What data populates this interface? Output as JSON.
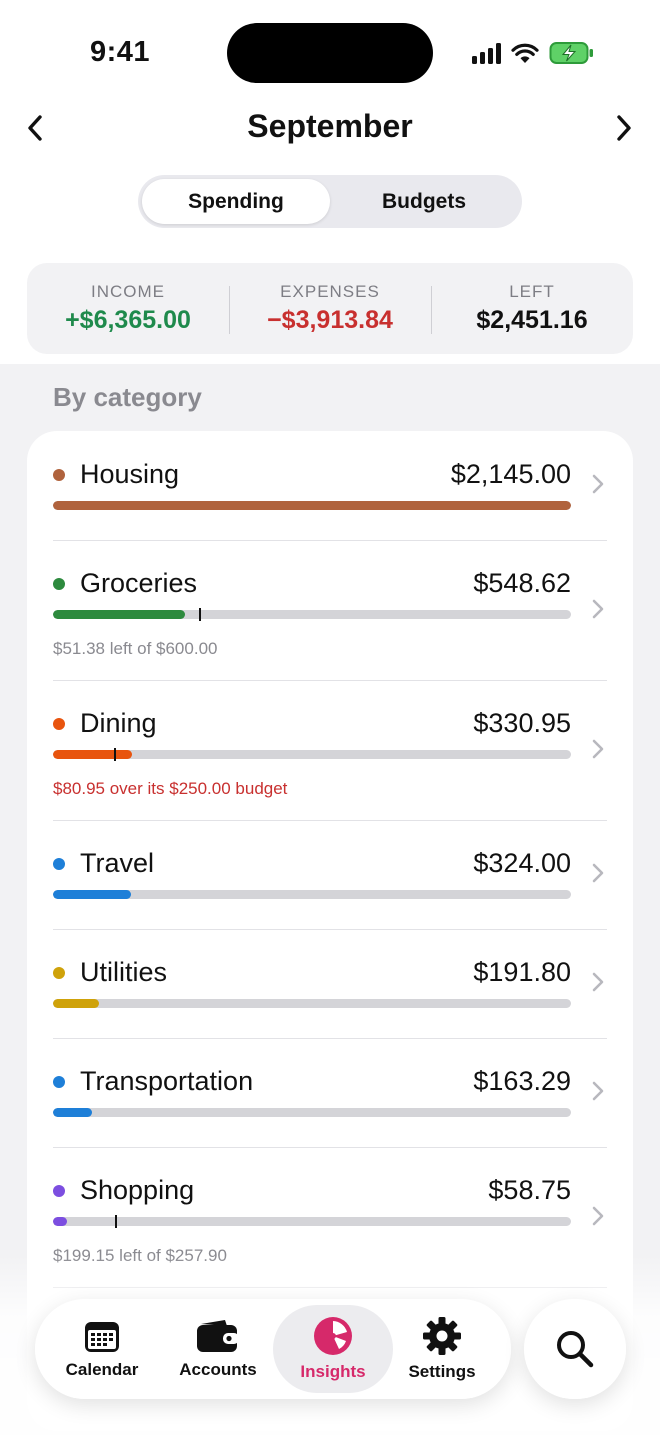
{
  "status_bar": {
    "time": "9:41"
  },
  "header": {
    "title": "September"
  },
  "segmented": {
    "spending": "Spending",
    "budgets": "Budgets",
    "selected": "Spending"
  },
  "summary": {
    "income_label": "INCOME",
    "income_value": "+$6,365.00",
    "expenses_label": "EXPENSES",
    "expenses_value": "−$3,913.84",
    "left_label": "LEFT",
    "left_value": "$2,451.16"
  },
  "section": {
    "title": "By category"
  },
  "categories": [
    {
      "name": "Housing",
      "amount": "$2,145.00",
      "color": "#b0633d",
      "fill": 1.0,
      "marker": null,
      "note": ""
    },
    {
      "name": "Groceries",
      "amount": "$548.62",
      "color": "#2d8a3e",
      "fill": 0.255,
      "marker": 0.282,
      "note": "$51.38 left of $600.00"
    },
    {
      "name": "Dining",
      "amount": "$330.95",
      "color": "#e8540e",
      "fill": 0.153,
      "marker": 0.118,
      "note": "$80.95 over its $250.00 budget",
      "note_over": true
    },
    {
      "name": "Travel",
      "amount": "$324.00",
      "color": "#1e7fd8",
      "fill": 0.151,
      "marker": null,
      "note": ""
    },
    {
      "name": "Utilities",
      "amount": "$191.80",
      "color": "#cfa20a",
      "fill": 0.089,
      "marker": null,
      "note": ""
    },
    {
      "name": "Transportation",
      "amount": "$163.29",
      "color": "#1e7fd8",
      "fill": 0.076,
      "marker": null,
      "note": ""
    },
    {
      "name": "Shopping",
      "amount": "$58.75",
      "color": "#7c4ee0",
      "fill": 0.027,
      "marker": 0.12,
      "note": "$199.15 left of $257.90"
    }
  ],
  "tabbar": {
    "calendar": "Calendar",
    "accounts": "Accounts",
    "insights": "Insights",
    "settings": "Settings",
    "active": "Insights"
  },
  "colors": {
    "accent": "#d6296a",
    "income": "#1f8a4c",
    "expenses": "#c8302f"
  }
}
